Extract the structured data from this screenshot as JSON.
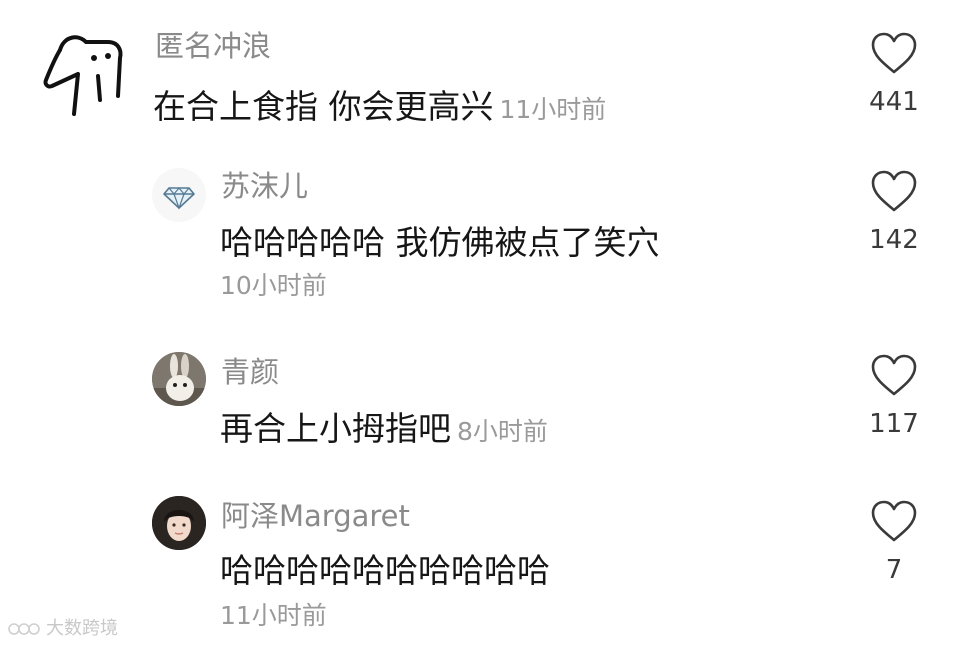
{
  "comments": [
    {
      "name": "匿名冲浪",
      "text": "在合上食指 你会更高兴",
      "time": "11小时前",
      "likes": "441",
      "avatar": "dog-sketch-avatar"
    },
    {
      "name": "苏沫儿",
      "text": "哈哈哈哈哈 我仿佛被点了笑穴",
      "time": "10小时前",
      "likes": "142",
      "avatar": "diamond-avatar"
    },
    {
      "name": "青颜",
      "text": "再合上小拇指吧",
      "time": "8小时前",
      "likes": "117",
      "avatar": "rabbit-photo-avatar"
    },
    {
      "name": "阿泽Margaret",
      "text": "哈哈哈哈哈哈哈哈哈哈",
      "time": "11小时前",
      "likes": "7",
      "avatar": "girl-photo-avatar"
    }
  ],
  "icons": {
    "like": "heart-outline-icon"
  },
  "colors": {
    "name": "#8a8a8a",
    "text": "#161616",
    "time": "#9a9a9a",
    "heart_stroke": "#3a3a3a"
  },
  "watermark": {
    "text": "大数跨境"
  }
}
